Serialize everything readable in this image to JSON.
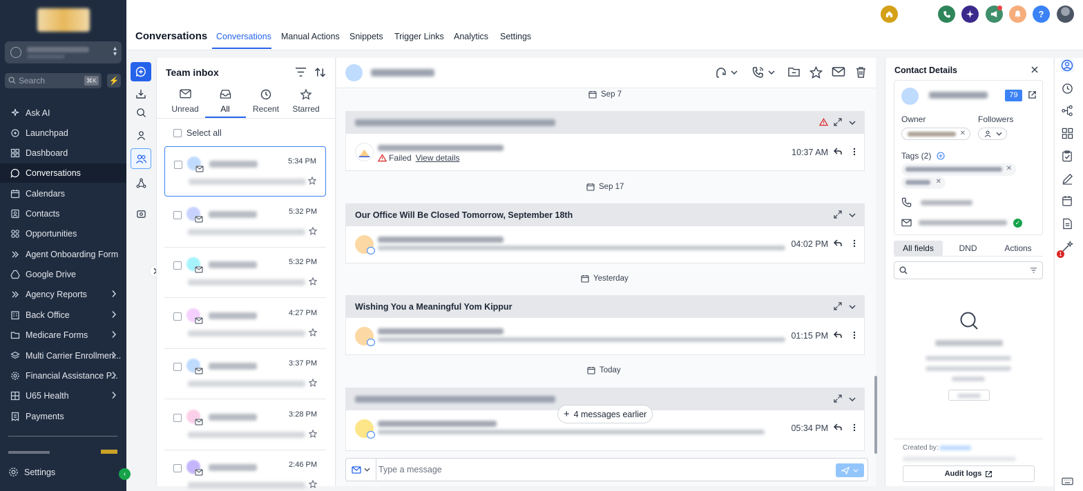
{
  "nav": {
    "search_placeholder": "Search",
    "search_shortcut": "⌘K",
    "items": [
      {
        "label": "Ask AI",
        "icon": "sparkle-icon"
      },
      {
        "label": "Launchpad",
        "icon": "rocket-icon"
      },
      {
        "label": "Dashboard",
        "icon": "dashboard-icon"
      },
      {
        "label": "Conversations",
        "icon": "chat-bubble-icon",
        "active": true
      },
      {
        "label": "Calendars",
        "icon": "calendar-icon"
      },
      {
        "label": "Contacts",
        "icon": "contacts-icon"
      },
      {
        "label": "Opportunities",
        "icon": "opportunities-icon"
      },
      {
        "label": "Agent Onboarding Form",
        "icon": "double-chevron-icon"
      },
      {
        "label": "Google Drive",
        "icon": "drive-icon"
      },
      {
        "label": "Agency Reports",
        "icon": "double-chevron-icon",
        "submenu": true
      },
      {
        "label": "Back Office",
        "icon": "building-icon",
        "submenu": true
      },
      {
        "label": "Medicare Forms",
        "icon": "folder-icon",
        "submenu": true
      },
      {
        "label": "Multi Carrier Enrollmen...",
        "icon": "layers-icon",
        "submenu": true
      },
      {
        "label": "Financial Assistance P...",
        "icon": "gear-icon",
        "submenu": true
      },
      {
        "label": "U65 Health",
        "icon": "grid-icon",
        "submenu": true
      },
      {
        "label": "Payments",
        "icon": "receipt-icon"
      }
    ],
    "settings_label": "Settings"
  },
  "header": {
    "title": "Conversations",
    "tabs": [
      "Conversations",
      "Manual Actions",
      "Snippets",
      "Trigger Links",
      "Analytics",
      "Settings"
    ],
    "active_tab": "Conversations",
    "help_glyph": "?"
  },
  "inbox": {
    "title": "Team inbox",
    "filter_tabs": [
      {
        "label": "Unread",
        "icon": "mail-icon"
      },
      {
        "label": "All",
        "icon": "inbox-tray-icon",
        "active": true
      },
      {
        "label": "Recent",
        "icon": "clock-icon"
      },
      {
        "label": "Starred",
        "icon": "star-icon"
      }
    ],
    "select_all": "Select all",
    "conversations": [
      {
        "time": "5:34 PM",
        "avatar_color": "#bfdbfe",
        "selected": true
      },
      {
        "time": "5:32 PM",
        "avatar_color": "#c7d2fe"
      },
      {
        "time": "5:32 PM",
        "avatar_color": "#a5f3fc"
      },
      {
        "time": "4:27 PM",
        "avatar_color": "#f5d0fe"
      },
      {
        "time": "3:37 PM",
        "avatar_color": "#bfdbfe"
      },
      {
        "time": "3:28 PM",
        "avatar_color": "#fbcfe8"
      },
      {
        "time": "2:46 PM",
        "avatar_color": "#c4b5fd"
      }
    ]
  },
  "thread": {
    "date_separators": [
      "Sep 7",
      "Sep 17",
      "Yesterday",
      "Today"
    ],
    "cards": [
      {
        "subject_blurred": true,
        "failed_label": "Failed",
        "view_details": "View details",
        "time": "10:37 AM",
        "has_warning": true
      },
      {
        "subject": "Our Office Will Be Closed Tomorrow, September 18th",
        "time": "04:02 PM"
      },
      {
        "subject": "Wishing You a Meaningful Yom Kippur",
        "time": "01:15 PM"
      },
      {
        "subject_blurred": true,
        "time": "05:34 PM"
      }
    ],
    "earlier_label": "4 messages earlier",
    "composer_placeholder": "Type a message"
  },
  "contact": {
    "title": "Contact Details",
    "score": "79",
    "owner_label": "Owner",
    "followers_label": "Followers",
    "tags_label": "Tags (2)",
    "tabs": [
      "All fields",
      "DND",
      "Actions"
    ],
    "created_by_label": "Created by:",
    "audit_logs": "Audit logs"
  },
  "right_rail": {
    "badge": "1"
  },
  "colors": {
    "accent": "#2563eb",
    "nav_bg": "#1f2c40",
    "home_btn": "#d4a017",
    "phone_btn": "#2f855a",
    "ai_btn": "#3b2a8c",
    "megaphone_btn": "#3f8f6b",
    "bell_btn": "#f6ad7b",
    "help_btn": "#3b82f6"
  }
}
